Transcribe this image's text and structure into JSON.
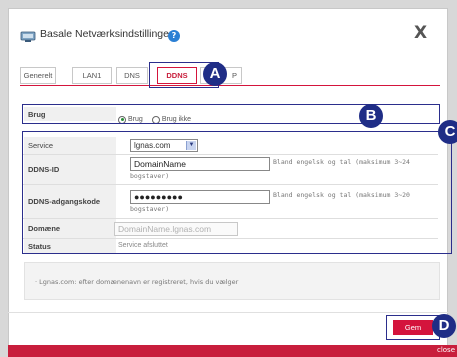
{
  "dialog": {
    "title": "Basale Netværksindstillinger",
    "close_label": "X",
    "help_icon": "question-circle-icon"
  },
  "tabs": [
    {
      "label": "Generelt"
    },
    {
      "label": "LAN1"
    },
    {
      "label": "DNS"
    },
    {
      "label": "DDNS",
      "active": true
    },
    {
      "label": "P"
    }
  ],
  "markers": {
    "a": "A",
    "b": "B",
    "c": "C",
    "d": "D"
  },
  "usage": {
    "label": "Brug",
    "option_use": "Brug",
    "option_no_use": "Brug ikke",
    "selected": "Brug"
  },
  "service": {
    "label": "Service",
    "selected": "lgnas.com"
  },
  "ddns_id": {
    "label": "DDNS-ID",
    "value": "DomainName",
    "hint_line1": "Bland engelsk og tal (maksimum 3~24",
    "hint_line2": "bogstaver)"
  },
  "ddns_password": {
    "label": "DDNS-adgangskode",
    "value": "●●●●●●●●●",
    "hint_line1": "Bland engelsk og tal (maksimum 3~20",
    "hint_line2": "bogstaver)"
  },
  "domain": {
    "label": "Domæne",
    "value": "DomainName.lgnas.com"
  },
  "status": {
    "label": "Status",
    "value": "Service afsluttet"
  },
  "info": {
    "text": "· Lgnas.com: efter domænenavn er registreret, hvis du vælger"
  },
  "footer": {
    "save_label": "Gem",
    "corner_label": "close"
  },
  "colors": {
    "accent": "#d4143c",
    "marker": "#1f2d86",
    "outline": "#2b2e8c"
  }
}
